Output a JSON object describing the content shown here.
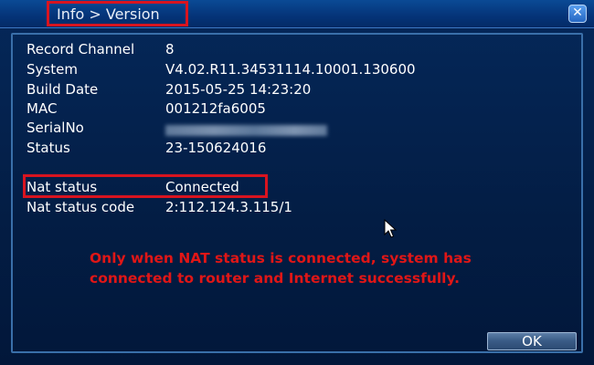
{
  "titlebar": {
    "title": "Info > Version",
    "close_icon": "close-icon"
  },
  "info": {
    "rows": [
      {
        "label": "Record Channel",
        "value": "8"
      },
      {
        "label": "System",
        "value": "V4.02.R11.34531114.10001.130600"
      },
      {
        "label": "Build Date",
        "value": "2015-05-25 14:23:20"
      },
      {
        "label": "MAC",
        "value": "001212fa6005"
      },
      {
        "label": "SerialNo",
        "value": ""
      },
      {
        "label": "Status",
        "value": "23-150624016"
      }
    ],
    "nat_rows": [
      {
        "label": "Nat status",
        "value": "Connected"
      },
      {
        "label": "Nat status code",
        "value": "2:112.124.3.115/1"
      }
    ]
  },
  "note": {
    "line1": "Only when NAT status is connected, system has",
    "line2": "connected to router and Internet successfully."
  },
  "footer": {
    "ok_label": "OK"
  },
  "colors": {
    "highlight": "#d9141f",
    "note_text": "#e01616",
    "background": "#03214d"
  }
}
